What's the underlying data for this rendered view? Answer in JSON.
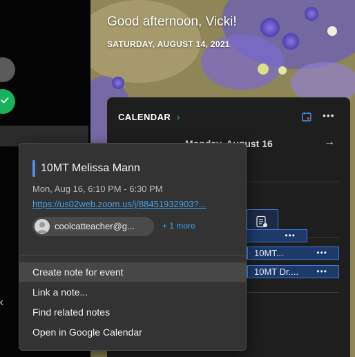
{
  "greeting": "Good afternoon, Vicki!",
  "date_line": "SATURDAY, AUGUST 14, 2021",
  "left_panel": {
    "cut_text": "k"
  },
  "calendar": {
    "title": "CALENDAR",
    "chevron": "›",
    "more": "•••",
    "prev": "←",
    "day_label": "Monday, August 16",
    "next": "→",
    "events": [
      {
        "label": "",
        "dots": "•••"
      },
      {
        "label": "10MT...",
        "dots": "•••"
      },
      {
        "label": "10MT Dr....",
        "dots": "•••"
      }
    ]
  },
  "popup": {
    "title": "10MT Melissa Mann",
    "time": "Mon, Aug 16, 6:10 PM - 6:30 PM",
    "link": "https://us02web.zoom.us/j/88451932903?...",
    "attendee": "coolcatteacher@g...",
    "more_attendees": "+ 1 more",
    "menu": [
      "Create note for event",
      "Link a note...",
      "Find related notes",
      "Open in Google Calendar"
    ]
  },
  "colors": {
    "accent_blue": "#4d8df0",
    "accent_green": "#2ecc71",
    "link": "#3ea2f2"
  },
  "icons": [
    "checkmark-icon",
    "calendar-icon",
    "note-icon",
    "avatar-icon"
  ]
}
